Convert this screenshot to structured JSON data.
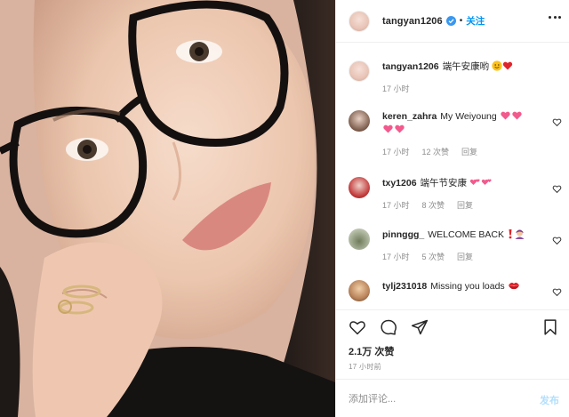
{
  "post": {
    "photo_description_icon": "selfie-photo"
  },
  "header": {
    "username": "tangyan1206",
    "dot": "•",
    "follow_label": "关注"
  },
  "caption": {
    "username": "tangyan1206",
    "text": "端午安康哟",
    "emojis": [
      "smiling-face",
      "red-heart"
    ],
    "time": "17 小时"
  },
  "comments": [
    {
      "username": "keren_zahra",
      "text": "My Weiyoung",
      "emojis": [
        "sparkling-heart",
        "sparkling-heart",
        "sparkling-heart",
        "sparkling-heart"
      ],
      "time": "17 小时",
      "likes": "12 次赞",
      "reply": "回复"
    },
    {
      "username": "txy1206",
      "text": "端午节安康",
      "emojis": [
        "two-hearts",
        "two-hearts"
      ],
      "time": "17 小时",
      "likes": "8 次赞",
      "reply": "回复"
    },
    {
      "username": "pinnggg_",
      "text": "WELCOME BACK",
      "emojis": [
        "exclamation",
        "person-bowing"
      ],
      "time": "17 小时",
      "likes": "5 次赞",
      "reply": "回复"
    },
    {
      "username": "tylj231018",
      "text": "Missing you loads",
      "emojis": [
        "kiss-mark"
      ],
      "time": "",
      "likes": "",
      "reply": ""
    }
  ],
  "actions": {
    "like_count": "2.1万 次赞",
    "post_time": "17 小时前"
  },
  "add_comment": {
    "placeholder": "添加评论...",
    "publish_label": "发布"
  },
  "colors": {
    "accent": "#0095f6",
    "publish_disabled": "#b2dffc",
    "text": "#262626",
    "muted": "#8e8e8e",
    "heart_red": "#ed4956",
    "heart_pink": "#f25a8e"
  }
}
